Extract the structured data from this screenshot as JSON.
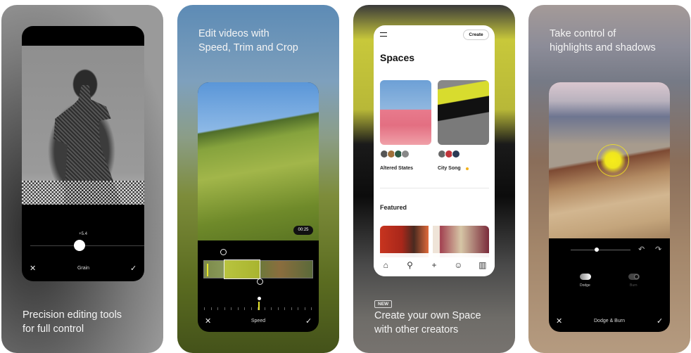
{
  "cards": [
    {
      "caption": [
        "Precision editing tools",
        "for full control"
      ],
      "tool": {
        "name": "Grain",
        "value": "+5.4",
        "slider_fraction": 0.46,
        "cancel_icon": "close-icon",
        "confirm_icon": "check-icon"
      }
    },
    {
      "caption": [
        "Edit videos with",
        "Speed, Trim and Crop"
      ],
      "tool": {
        "name": "Speed",
        "timestamp": "00:25",
        "trim_start_fraction": 0.19,
        "trim_end_fraction": 0.52,
        "cancel_icon": "close-icon",
        "confirm_icon": "check-icon"
      }
    },
    {
      "badge": "NEW",
      "caption": [
        "Create your own Space",
        "with other creators"
      ],
      "app": {
        "create_label": "Create",
        "title": "Spaces",
        "spaces": [
          {
            "name": "Altered States",
            "avatars": 4,
            "live": false
          },
          {
            "name": "City Song",
            "avatars": 3,
            "live": true
          }
        ],
        "featured_title": "Featured",
        "tabbar": [
          "home-icon",
          "search-icon",
          "plus-icon",
          "emoji-icon",
          "library-icon"
        ]
      },
      "colors": {
        "live_dot": "#f2b21c"
      }
    },
    {
      "caption": [
        "Take control of",
        "highlights and shadows"
      ],
      "tool": {
        "name": "Dodge & Burn",
        "modes": [
          "Dodge",
          "Burn"
        ],
        "active_mode": "Dodge",
        "slider_fraction": 0.4,
        "cancel_icon": "close-icon",
        "confirm_icon": "check-icon"
      }
    }
  ],
  "colors": {
    "accent_yellow": "#e9e62c"
  }
}
